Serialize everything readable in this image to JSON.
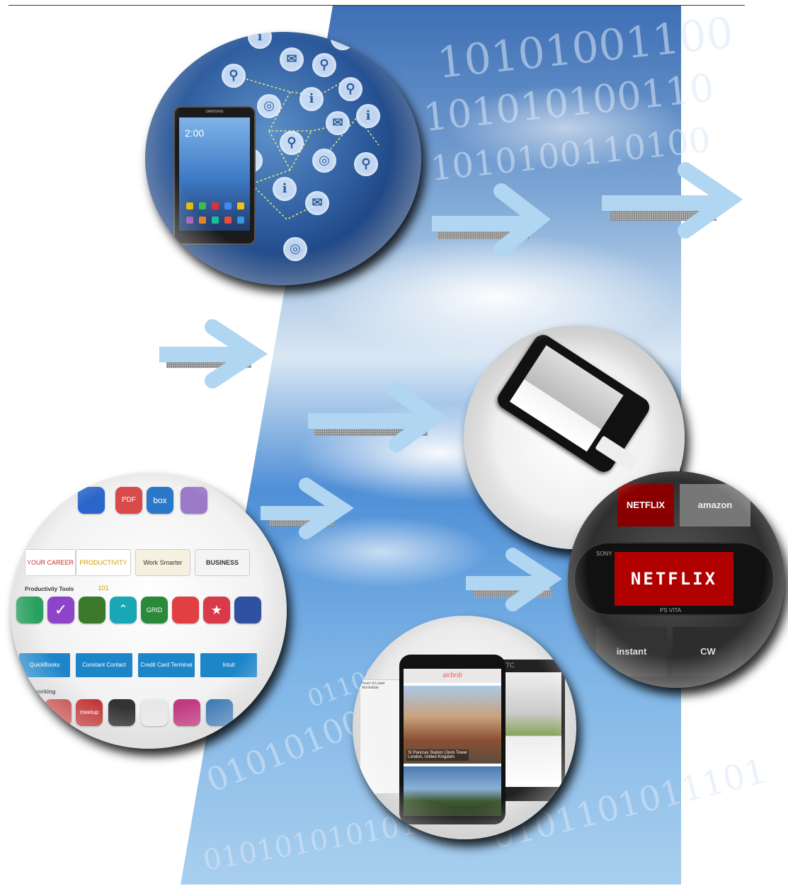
{
  "scene": {
    "description_free": true
  },
  "tablet_circle": {
    "clock": "2:00",
    "brand": "SAMSUNG",
    "bubble_glyphs": [
      "i",
      "i",
      "i",
      "i",
      "i"
    ]
  },
  "netflix_circle": {
    "screen_text": "NETFLIX",
    "vita_brand": "PS VITA",
    "sony": "SONY",
    "tile_top_left": "NETFLIX",
    "tile_top_right": "amazon",
    "tile_bottom_left": "instant",
    "tile_bottom_right": "CW"
  },
  "apps_circle": {
    "section_heading": "Productivity Tools",
    "section_heading_2": "Networking",
    "banners": [
      "YOUR CAREER",
      "PRODUCTIVITY 101",
      "Work Smarter",
      "BUSINESS"
    ],
    "bars": [
      "QuickBooks",
      "Constant Contact",
      "Credit Card Terminal",
      "Intuit"
    ],
    "icon_labels": [
      "box",
      "PDF",
      "GRID",
      "meetup"
    ],
    "colors": {
      "icons_row1": [
        "#2aa060",
        "#8e44c9",
        "#3a7a2a",
        "#1aa7b5",
        "#2a8a3a",
        "#e04040",
        "#d83a4a",
        "#3050a0"
      ],
      "icons_row2": [
        "#c04040",
        "#c03030",
        "#333333",
        "#e8e8e8",
        "#c03a80",
        "#3070b0",
        "#3a9a3a"
      ]
    }
  },
  "airbnb_circle": {
    "app_name": "airbnb",
    "photo_caption": "St Pancras Station Clock Tower",
    "photo_subcaption": "London, United Kingdom",
    "htc_brand": "HTC",
    "web_text": "Heart of Lower Manhattan"
  }
}
